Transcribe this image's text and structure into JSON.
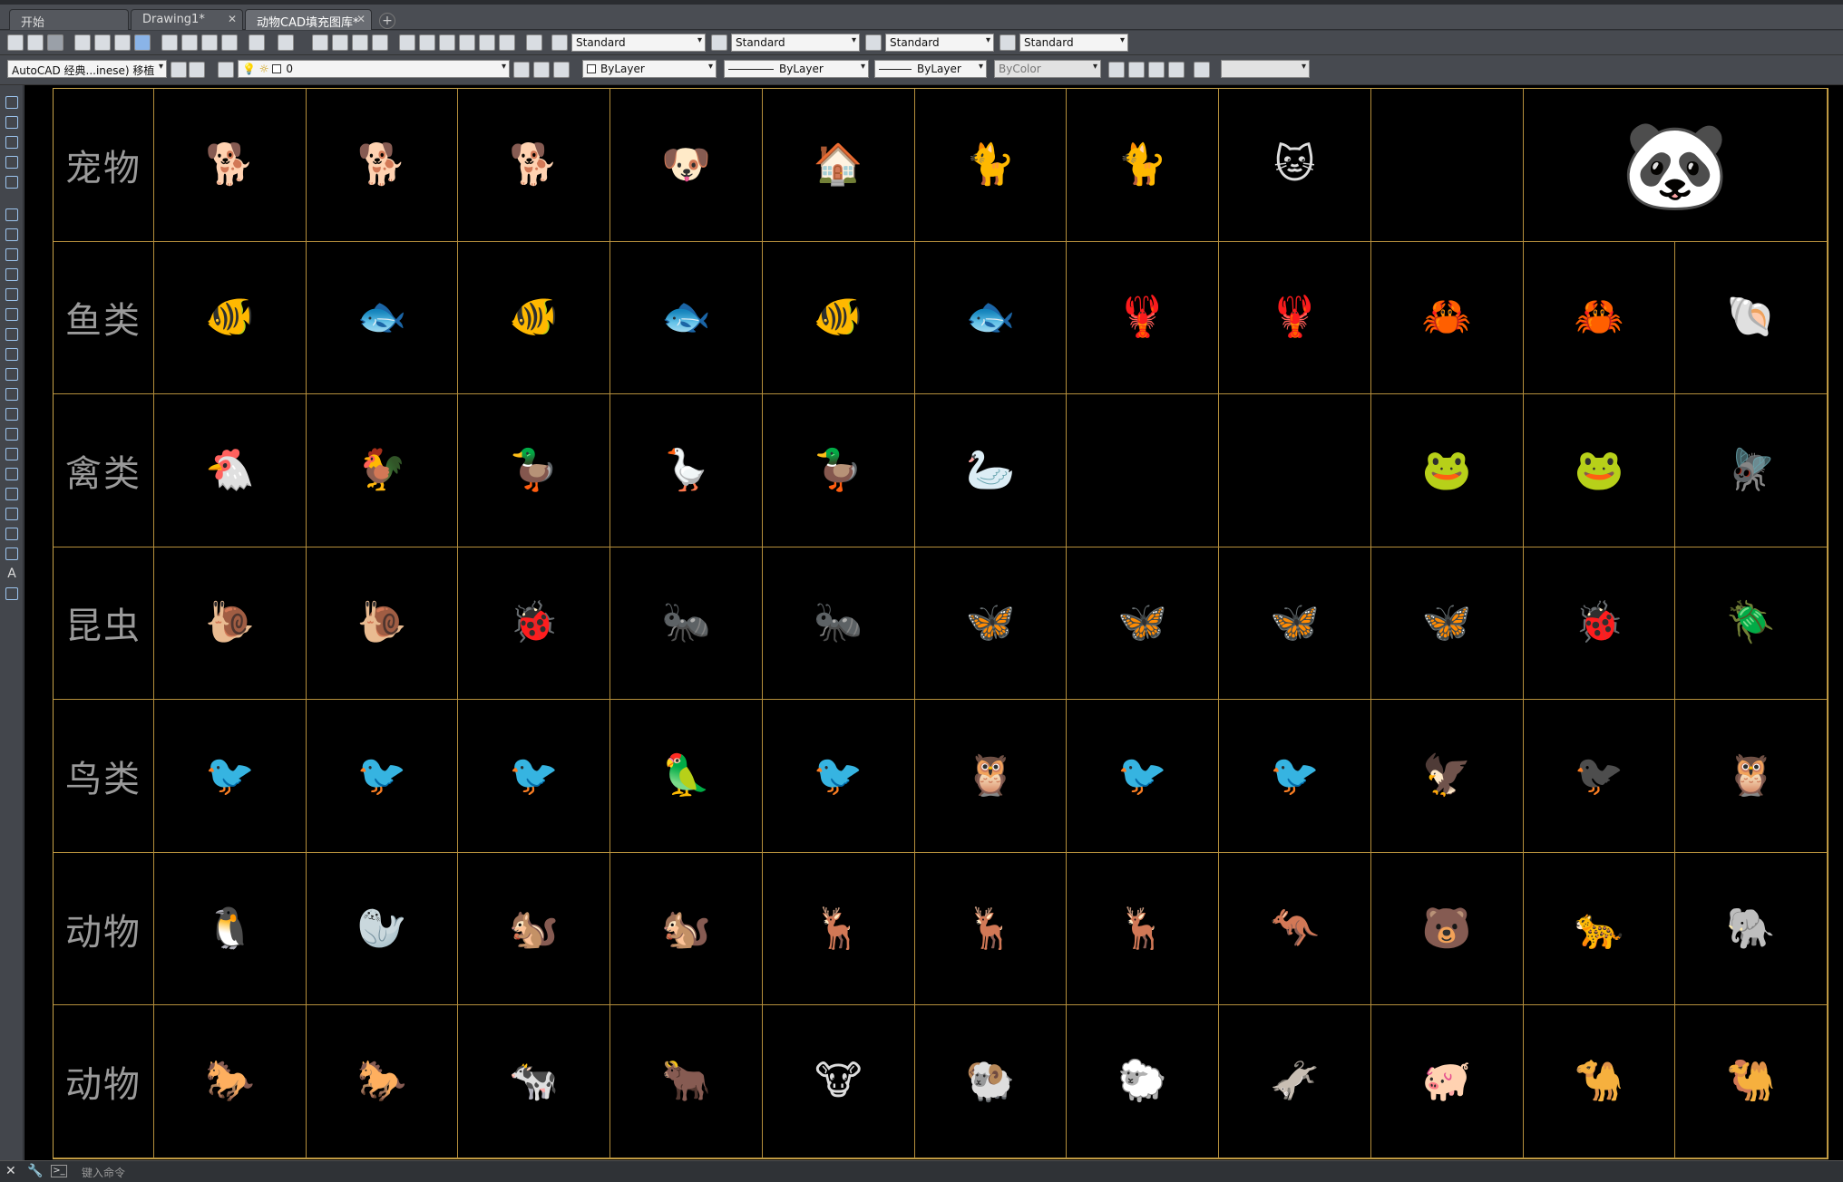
{
  "tabs": [
    {
      "label": "开始",
      "closable": false,
      "active": false
    },
    {
      "label": "Drawing1*",
      "closable": true,
      "active": false
    },
    {
      "label": "动物CAD填充图库*",
      "closable": true,
      "active": true
    }
  ],
  "toolbar1": {
    "textStyle": "Standard",
    "dimStyle": "Standard",
    "tableStyle": "Standard",
    "mleaderStyle": "Standard"
  },
  "toolbar2": {
    "workspace": "AutoCAD 经典...inese) 移植",
    "layer": "0",
    "color": "ByLayer",
    "linetype": "ByLayer",
    "lineweight": "ByLayer",
    "plotStyle": "ByColor",
    "extra": ""
  },
  "grid": {
    "rows": [
      {
        "category": "宠物",
        "animals": [
          "dog-yellow-icon",
          "dog-beagle-icon",
          "dog-sign-icon",
          "dog-small-icon",
          "dog-house-icon",
          "cat-kittens-icon",
          "cat-box-icon",
          "cat-grey-icon",
          "",
          "panda-icon"
        ]
      },
      {
        "category": "鱼类",
        "animals": [
          "fish-butterflyfish-icon",
          "fish-brown-icon",
          "fish-angelfish-icon",
          "fish-goldfish-icon",
          "fish-goldfish-fantail-icon",
          "fish-arowana-icon",
          "crayfish-red-icon",
          "lobster-red-icon",
          "crab-orange-icon",
          "crab-small-icon",
          "shells-icon"
        ]
      },
      {
        "category": "禽类",
        "animals": [
          "hen-brown-icon",
          "rooster-white-icon",
          "duck-mallard-icon",
          "goose-grey-icon",
          "duck-mandarin-icon",
          "swan-white-icon",
          "",
          "",
          "frog-blue-icon",
          "frog-green-icon",
          "fly-icon"
        ]
      },
      {
        "category": "昆虫",
        "animals": [
          "snail-brown-icon",
          "snail-white-icon",
          "ladybug-big-icon",
          "ant-grey-icon",
          "ant-red-icon",
          "moth-atlas-icon",
          "butterfly-white-icon",
          "butterfly-peacock-icon",
          "butterfly-red-icon",
          "ladybug-orange-icon",
          "cicada-icon"
        ]
      },
      {
        "category": "鸟类",
        "animals": [
          "oriole-icon",
          "junco-icon",
          "bunting-icon",
          "parrot-small-icon",
          "hummingbird-feeder-icon",
          "snowy-owl-icon",
          "partridge-icon",
          "sandpiper-icon",
          "eagle-icon",
          "raven-icon",
          "owl-flying-icon"
        ]
      },
      {
        "category": "动物",
        "animals": [
          "penguins-icon",
          "sea-lion-ball-icon",
          "red-squirrel-icon",
          "grey-squirrel-icon",
          "gazelle-icon",
          "fawn-icon",
          "deer-stag-icon",
          "kangaroo-icon",
          "bear-face-icon",
          "cougar-face-icon",
          "elephant-icon"
        ]
      },
      {
        "category": "动物",
        "animals": [
          "horse-white-icon",
          "horse-brown-icon",
          "cow-spotted-icon",
          "ox-cart-icon",
          "cow-head-icon",
          "ram-icon",
          "sheep-white-icon",
          "donkey-icon",
          "pigs-icon",
          "camel-one-hump-icon",
          "camel-two-hump-icon"
        ]
      }
    ]
  },
  "emoji": {
    "dog-yellow-icon": "🐕",
    "dog-beagle-icon": "🐕",
    "dog-sign-icon": "🐕",
    "dog-small-icon": "🐶",
    "dog-house-icon": "🏠",
    "cat-kittens-icon": "🐈",
    "cat-box-icon": "🐈",
    "cat-grey-icon": "🐱",
    "panda-icon": "🐼",
    "fish-butterflyfish-icon": "🐠",
    "fish-brown-icon": "🐟",
    "fish-angelfish-icon": "🐠",
    "fish-goldfish-icon": "🐟",
    "fish-goldfish-fantail-icon": "🐠",
    "fish-arowana-icon": "🐟",
    "crayfish-red-icon": "🦞",
    "lobster-red-icon": "🦞",
    "crab-orange-icon": "🦀",
    "crab-small-icon": "🦀",
    "shells-icon": "🐚",
    "hen-brown-icon": "🐔",
    "rooster-white-icon": "🐓",
    "duck-mallard-icon": "🦆",
    "goose-grey-icon": "🪿",
    "duck-mandarin-icon": "🦆",
    "swan-white-icon": "🦢",
    "frog-blue-icon": "🐸",
    "frog-green-icon": "🐸",
    "fly-icon": "🪰",
    "snail-brown-icon": "🐌",
    "snail-white-icon": "🐌",
    "ladybug-big-icon": "🐞",
    "ant-grey-icon": "🐜",
    "ant-red-icon": "🐜",
    "moth-atlas-icon": "🦋",
    "butterfly-white-icon": "🦋",
    "butterfly-peacock-icon": "🦋",
    "butterfly-red-icon": "🦋",
    "ladybug-orange-icon": "🐞",
    "cicada-icon": "🪲",
    "oriole-icon": "🐦",
    "junco-icon": "🐦",
    "bunting-icon": "🐦",
    "parrot-small-icon": "🦜",
    "hummingbird-feeder-icon": "🐦",
    "snowy-owl-icon": "🦉",
    "partridge-icon": "🐦",
    "sandpiper-icon": "🐦",
    "eagle-icon": "🦅",
    "raven-icon": "🐦‍⬛",
    "owl-flying-icon": "🦉",
    "penguins-icon": "🐧",
    "sea-lion-ball-icon": "🦭",
    "red-squirrel-icon": "🐿️",
    "grey-squirrel-icon": "🐿️",
    "gazelle-icon": "🦌",
    "fawn-icon": "🦌",
    "deer-stag-icon": "🦌",
    "kangaroo-icon": "🦘",
    "bear-face-icon": "🐻",
    "cougar-face-icon": "🐆",
    "elephant-icon": "🐘",
    "horse-white-icon": "🐎",
    "horse-brown-icon": "🐎",
    "cow-spotted-icon": "🐄",
    "ox-cart-icon": "🐂",
    "cow-head-icon": "🐮",
    "ram-icon": "🐏",
    "sheep-white-icon": "🐑",
    "donkey-icon": "🫏",
    "pigs-icon": "🐖",
    "camel-one-hump-icon": "🐪",
    "camel-two-hump-icon": "🐫"
  },
  "commandLine": {
    "placeholder": "键入命令"
  },
  "colors": {
    "gridLine": "#c9a44a",
    "canvas": "#000000",
    "categoryText": "#9a9a9a"
  }
}
